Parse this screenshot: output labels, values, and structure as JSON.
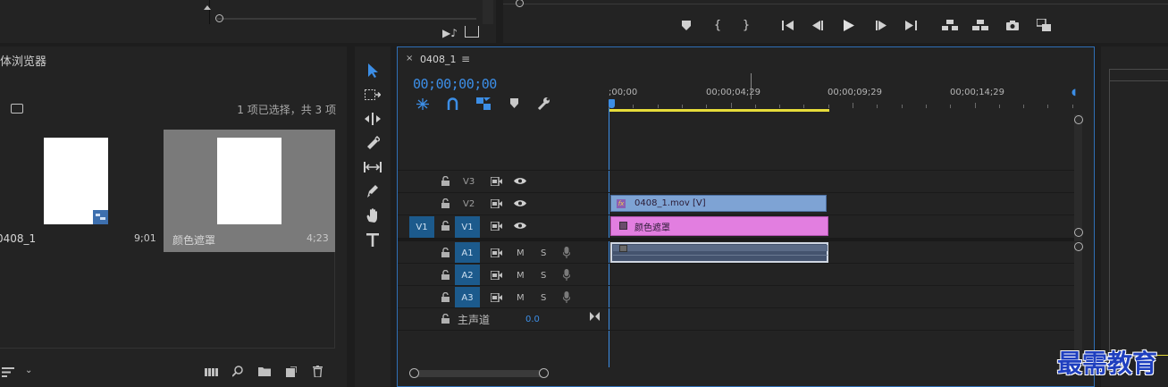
{
  "media_browser": {
    "title": "媒体浏览器",
    "selection_info": "1 项已选择，共 3 项",
    "clips": [
      {
        "name": "0408_1",
        "duration": "9;01"
      },
      {
        "name": "颜色遮罩",
        "duration": "4;23"
      }
    ]
  },
  "timeline": {
    "tab_label": "0408_1",
    "timecode": "00;00;00;00",
    "ruler_labels": [
      ";00;00",
      "00;00;04;29",
      "00;00;09;29",
      "00;00;14;29"
    ],
    "video_tracks": [
      {
        "name": "V3",
        "target": ""
      },
      {
        "name": "V2",
        "target": ""
      },
      {
        "name": "V1",
        "target": "V1"
      }
    ],
    "audio_tracks": [
      {
        "name": "A1",
        "mute": "M",
        "solo": "S"
      },
      {
        "name": "A2",
        "mute": "M",
        "solo": "S"
      },
      {
        "name": "A3",
        "mute": "M",
        "solo": "S"
      }
    ],
    "master_track": {
      "name": "主声道",
      "level": "0.0"
    },
    "clips": {
      "v2_clip": "0408_1.mov [V]",
      "v1_clip": "颜色遮罩"
    },
    "colors": {
      "v2_clip": "#7ea3d4",
      "v1_clip": "#e27ee0",
      "a1_clip": "#44536e",
      "work_area": "#e6dc3a",
      "accent": "#2f6fb6"
    }
  },
  "watermark": "最需教育"
}
